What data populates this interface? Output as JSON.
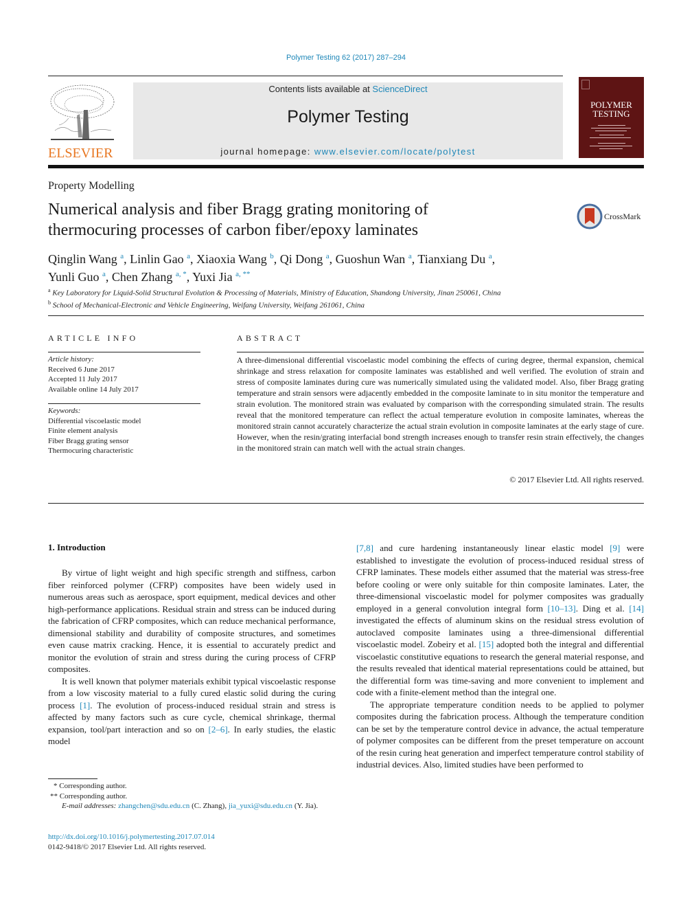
{
  "header": {
    "citation": "Polymer Testing 62 (2017) 287–294",
    "contents_prefix": "Contents lists available at ",
    "contents_link": "ScienceDirect",
    "journal_title": "Polymer Testing",
    "homepage_prefix": "journal homepage: ",
    "homepage_link": "www.elsevier.com/locate/polytest",
    "publisher_wordmark": "ELSEVIER",
    "cover_title_line1": "POLYMER",
    "cover_title_line2": "TESTING",
    "crossmark_label": "CrossMark"
  },
  "article": {
    "section": "Property Modelling",
    "title_line1": "Numerical analysis and fiber Bragg grating monitoring of",
    "title_line2": "thermocuring processes of carbon fiber/epoxy laminates",
    "authors": [
      {
        "name": "Qinglin Wang",
        "aff": "a",
        "sep": ", "
      },
      {
        "name": "Linlin Gao",
        "aff": "a",
        "sep": ", "
      },
      {
        "name": "Xiaoxia Wang",
        "aff": "b",
        "sep": ", "
      },
      {
        "name": "Qi Dong",
        "aff": "a",
        "sep": ", "
      },
      {
        "name": "Guoshun Wan",
        "aff": "a",
        "sep": ", "
      },
      {
        "name": "Tianxiang Du",
        "aff": "a",
        "sep": ","
      },
      {
        "name": "Yunli Guo",
        "aff": "a",
        "sep": ", "
      },
      {
        "name": "Chen Zhang",
        "aff": "a, *",
        "sep": ", "
      },
      {
        "name": "Yuxi Jia",
        "aff": "a, **",
        "sep": ""
      }
    ],
    "affiliations": [
      {
        "mark": "a",
        "text": "Key Laboratory for Liquid-Solid Structural Evolution & Processing of Materials, Ministry of Education, Shandong University, Jinan 250061, China"
      },
      {
        "mark": "b",
        "text": "School of Mechanical-Electronic and Vehicle Engineering, Weifang University, Weifang 261061, China"
      }
    ]
  },
  "article_info": {
    "heading": "ARTICLE INFO",
    "history_label": "Article history:",
    "history": [
      "Received 6 June 2017",
      "Accepted 11 July 2017",
      "Available online 14 July 2017"
    ],
    "keywords_label": "Keywords:",
    "keywords": [
      "Differential viscoelastic model",
      "Finite element analysis",
      "Fiber Bragg grating sensor",
      "Thermocuring characteristic"
    ]
  },
  "abstract": {
    "heading": "ABSTRACT",
    "text": "A three-dimensional differential viscoelastic model combining the effects of curing degree, thermal expansion, chemical shrinkage and stress relaxation for composite laminates was established and well verified. The evolution of strain and stress of composite laminates during cure was numerically simulated using the validated model. Also, fiber Bragg grating temperature and strain sensors were adjacently embedded in the composite laminate to in situ monitor the temperature and strain evolution. The monitored strain was evaluated by comparison with the corresponding simulated strain. The results reveal that the monitored temperature can reflect the actual temperature evolution in composite laminates, whereas the monitored strain cannot accurately characterize the actual strain evolution in composite laminates at the early stage of cure. However, when the resin/grating interfacial bond strength increases enough to transfer resin strain effectively, the changes in the monitored strain can match well with the actual strain changes.",
    "copyright": "© 2017 Elsevier Ltd. All rights reserved."
  },
  "body": {
    "intro_heading": "1.  Introduction",
    "p1": "By virtue of light weight and high specific strength and stiffness, carbon fiber reinforced polymer (CFRP) composites have been widely used in numerous areas such as aerospace, sport equipment, medical devices and other high-performance applications. Residual strain and stress can be induced during the fabrication of CFRP composites, which can reduce mechanical performance, dimensional stability and durability of composite structures, and sometimes even cause matrix cracking. Hence, it is essential to accurately predict and monitor the evolution of strain and stress during the curing process of CFRP composites.",
    "p2_a": "It is well known that polymer materials exhibit typical viscoelastic response from a low viscosity material to a fully cured elastic solid during the curing process ",
    "p2_ref1": "[1]",
    "p2_b": ". The evolution of process-induced residual strain and stress is affected by many factors such as cure cycle, chemical shrinkage, thermal expansion, tool/part interaction and so on ",
    "p2_ref2": "[2–6]",
    "p2_c": ". In early studies, the elastic model",
    "r1_ref1": "[7,8]",
    "r1_a": " and cure hardening instantaneously linear elastic model ",
    "r1_ref2": "[9]",
    "r1_b": " were established to investigate the evolution of process-induced residual stress of CFRP laminates. These models either assumed that the material was stress-free before cooling or were only suitable for thin composite laminates. Later, the three-dimensional viscoelastic model for polymer composites was gradually employed in a general convolution integral form ",
    "r1_ref3": "[10–13]",
    "r1_c": ". Ding et al. ",
    "r1_ref4": "[14]",
    "r1_d": " investigated the effects of aluminum skins on the residual stress evolution of autoclaved composite laminates using a three-dimensional differential viscoelastic model. Zobeiry et al. ",
    "r1_ref5": "[15]",
    "r1_e": " adopted both the integral and differential viscoelastic constitutive equations to research the general material response, and the results revealed that identical material representations could be attained, but the differential form was time-saving and more convenient to implement and code with a finite-element method than the integral one.",
    "r2": "The appropriate temperature condition needs to be applied to polymer composites during the fabrication process. Although the temperature condition can be set by the temperature control device in advance, the actual temperature of polymer composites can be different from the preset temperature on account of the resin curing heat generation and imperfect temperature control stability of industrial devices. Also, limited studies have been performed to"
  },
  "footnotes": {
    "fn1": "* Corresponding author.",
    "fn2": "** Corresponding author.",
    "email_label": "E-mail addresses:",
    "email1": "zhangchen@sdu.edu.cn",
    "email1_name": " (C. Zhang), ",
    "email2": "jia_yuxi@sdu.edu.cn",
    "email2_name": " (Y. Jia).",
    "doi": "http://dx.doi.org/10.1016/j.polymertesting.2017.07.014",
    "issn": "0142-9418/© 2017 Elsevier Ltd. All rights reserved."
  },
  "colors": {
    "link": "#1e87b8",
    "elsevier_orange": "#e87722",
    "cover_bg": "#5e1414",
    "masthead_bg": "#e8e8e8"
  }
}
